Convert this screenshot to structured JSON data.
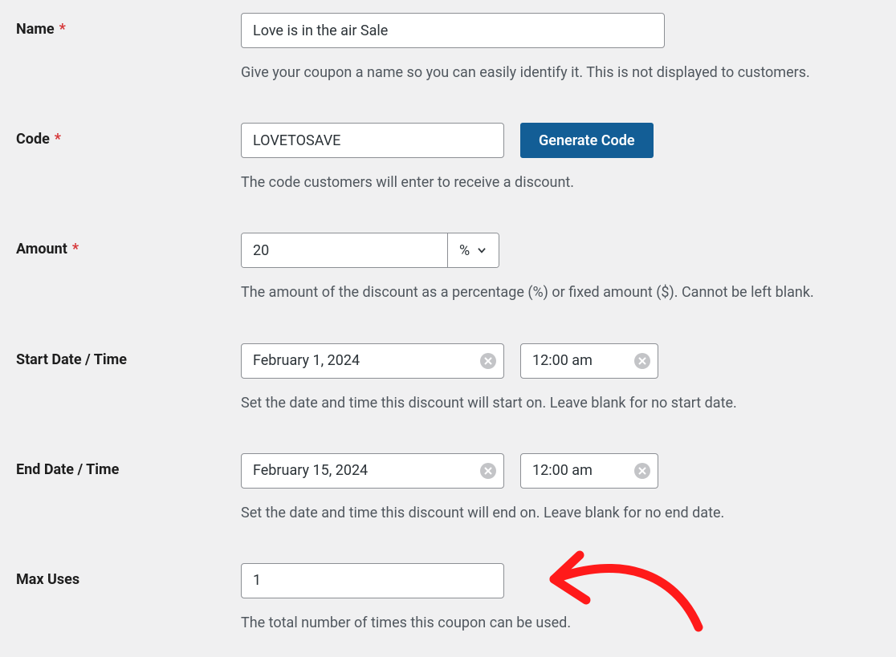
{
  "fields": {
    "name": {
      "label": "Name",
      "required": true,
      "value": "Love is in the air Sale",
      "help": "Give your coupon a name so you can easily identify it. This is not displayed to customers."
    },
    "code": {
      "label": "Code",
      "required": true,
      "value": "LOVETOSAVE",
      "generate_btn": "Generate Code",
      "help": "The code customers will enter to receive a discount."
    },
    "amount": {
      "label": "Amount",
      "required": true,
      "value": "20",
      "type_symbol": "%",
      "help": "The amount of the discount as a percentage (%) or fixed amount ($). Cannot be left blank."
    },
    "start": {
      "label": "Start Date / Time",
      "date": "February 1, 2024",
      "time": "12:00 am",
      "help": "Set the date and time this discount will start on. Leave blank for no start date."
    },
    "end": {
      "label": "End Date / Time",
      "date": "February 15, 2024",
      "time": "12:00 am",
      "help": "Set the date and time this discount will end on. Leave blank for no end date."
    },
    "max_uses": {
      "label": "Max Uses",
      "value": "1",
      "help": "The total number of times this coupon can be used."
    }
  }
}
